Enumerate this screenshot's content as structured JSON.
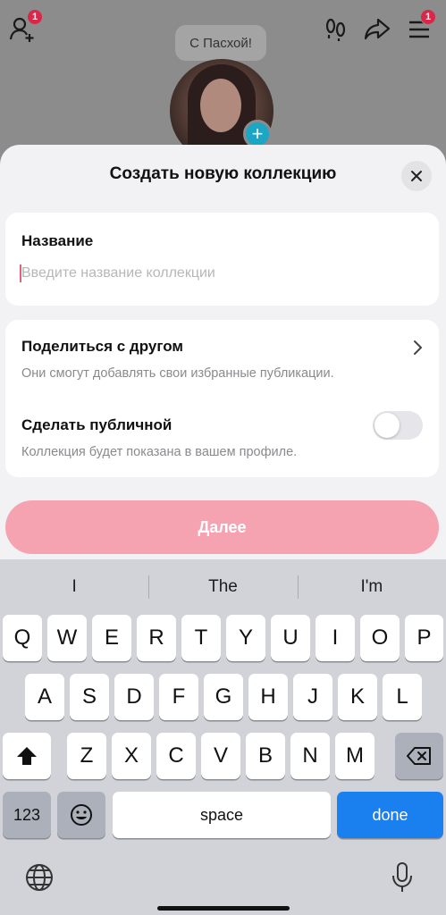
{
  "background": {
    "add_friend_badge": "1",
    "menu_badge": "1",
    "story_bubble": "С Пасхой!",
    "avatar_plus": "+"
  },
  "sheet": {
    "title": "Создать новую коллекцию",
    "name_section": {
      "label": "Название",
      "placeholder": "Введите название коллекции",
      "value": ""
    },
    "share": {
      "label": "Поделиться с другом",
      "description": "Они смогут добавлять свои избранные публикации."
    },
    "public": {
      "label": "Сделать публичной",
      "description": "Коллекция будет показана в вашем профиле.",
      "enabled": false
    },
    "next_button": "Далее"
  },
  "keyboard": {
    "suggestions": [
      "I",
      "The",
      "I'm"
    ],
    "row1": [
      "Q",
      "W",
      "E",
      "R",
      "T",
      "Y",
      "U",
      "I",
      "O",
      "P"
    ],
    "row2": [
      "A",
      "S",
      "D",
      "F",
      "G",
      "H",
      "J",
      "K",
      "L"
    ],
    "row3": [
      "Z",
      "X",
      "C",
      "V",
      "B",
      "N",
      "M"
    ],
    "numbers_key": "123",
    "space_key": "space",
    "done_key": "done"
  },
  "colors": {
    "accent_pink": "#f5a3b1",
    "badge_red": "#d7284a",
    "done_blue": "#1a80f0"
  }
}
